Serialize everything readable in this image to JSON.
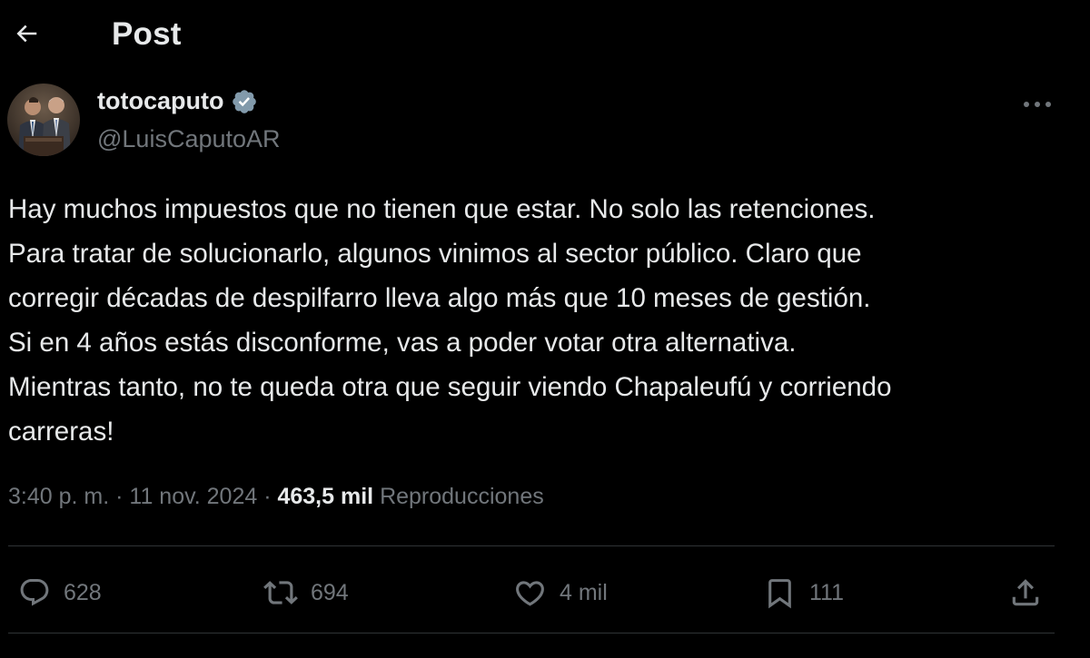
{
  "header": {
    "back_icon": "arrow-left-icon",
    "title": "Post"
  },
  "author": {
    "display_name": "totocaputo",
    "verified": true,
    "verified_color": "#829aab",
    "handle": "@LuisCaputoAR"
  },
  "tweet": {
    "lines": [
      "Hay muchos impuestos que no tienen que estar. No solo las retenciones.",
      "Para tratar de solucionarlo, algunos vinimos al sector público.  Claro que",
      "corregir décadas de despilfarro lleva algo más que 10 meses de gestión.",
      "Si en 4 años estás disconforme, vas a poder votar otra alternativa.",
      "Mientras tanto, no te queda otra que seguir viendo Chapaleufú y corriendo",
      "carreras!"
    ]
  },
  "meta": {
    "time": "3:40 p. m.",
    "separator": " · ",
    "date": "11 nov. 2024",
    "views_count": "463,5 mil",
    "views_label": "Reproducciones"
  },
  "actions": {
    "reply": {
      "icon": "reply-icon",
      "count": "628"
    },
    "repost": {
      "icon": "repost-icon",
      "count": "694"
    },
    "like": {
      "icon": "heart-icon",
      "count": "4 mil"
    },
    "bookmark": {
      "icon": "bookmark-icon",
      "count": "111"
    },
    "share": {
      "icon": "share-icon"
    }
  },
  "colors": {
    "background": "#000000",
    "text_primary": "#e7e9ea",
    "text_secondary": "#71767b",
    "divider": "#2f3336"
  }
}
